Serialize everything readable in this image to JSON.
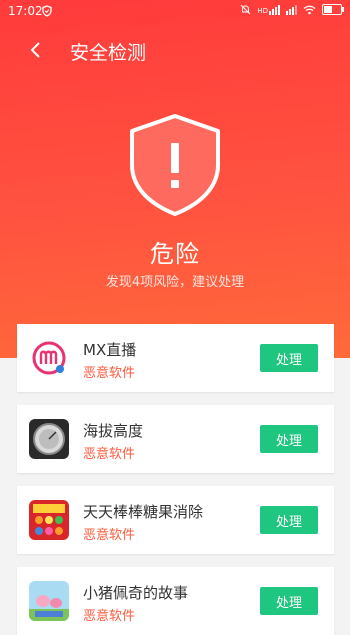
{
  "status_bar": {
    "time": "17:02",
    "network_label": "HD",
    "battery_level": 0.5
  },
  "header": {
    "title": "安全检测"
  },
  "summary": {
    "level": "危险",
    "description": "发现4项风险，建议处理"
  },
  "colors": {
    "hero_top": "#ff3b3b",
    "hero_bottom": "#ff6a3a",
    "action_green": "#1fc67f",
    "risk_text": "#ff5a3c"
  },
  "apps": [
    {
      "name": "MX直播",
      "tag": "恶意软件",
      "action": "处理",
      "icon": "mx-live-logo-icon"
    },
    {
      "name": "海拔高度",
      "tag": "恶意软件",
      "action": "处理",
      "icon": "altimeter-app-icon"
    },
    {
      "name": "天天棒棒糖果消除",
      "tag": "恶意软件",
      "action": "处理",
      "icon": "candy-game-icon"
    },
    {
      "name": "小猪佩奇的故事",
      "tag": "恶意软件",
      "action": "处理",
      "icon": "peppa-pig-app-icon"
    }
  ]
}
